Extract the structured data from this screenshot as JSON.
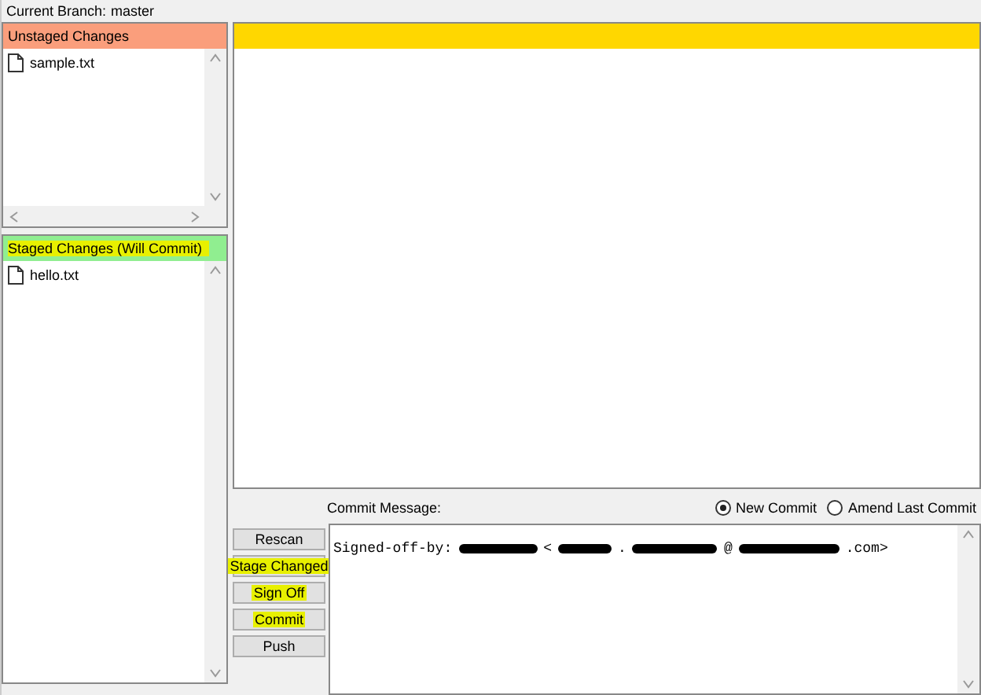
{
  "branch": {
    "label": "Current Branch:",
    "name": "master"
  },
  "unstaged": {
    "title": "Unstaged Changes",
    "highlighted": false,
    "files": [
      {
        "name": "sample.txt"
      }
    ]
  },
  "staged": {
    "title": "Staged Changes (Will Commit)",
    "highlighted": true,
    "files": [
      {
        "name": "hello.txt"
      }
    ]
  },
  "commit": {
    "label": "Commit Message:",
    "modes": [
      {
        "label": "New Commit",
        "selected": true
      },
      {
        "label": "Amend Last Commit",
        "selected": false
      }
    ],
    "buttons": [
      {
        "label": "Rescan",
        "highlighted": false
      },
      {
        "label": "Stage Changed",
        "highlighted": true
      },
      {
        "label": "Sign Off",
        "highlighted": true
      },
      {
        "label": "Commit",
        "highlighted": true
      },
      {
        "label": "Push",
        "highlighted": false
      }
    ],
    "message": [
      {
        "kind": "text",
        "text": "Signed-off-by:"
      },
      {
        "kind": "redacted"
      },
      {
        "kind": "text",
        "text": "<"
      },
      {
        "kind": "redacted"
      },
      {
        "kind": "text",
        "text": "."
      },
      {
        "kind": "redacted"
      },
      {
        "kind": "text",
        "text": "@"
      },
      {
        "kind": "redacted"
      },
      {
        "kind": "text",
        "text": ".com>"
      }
    ]
  }
}
